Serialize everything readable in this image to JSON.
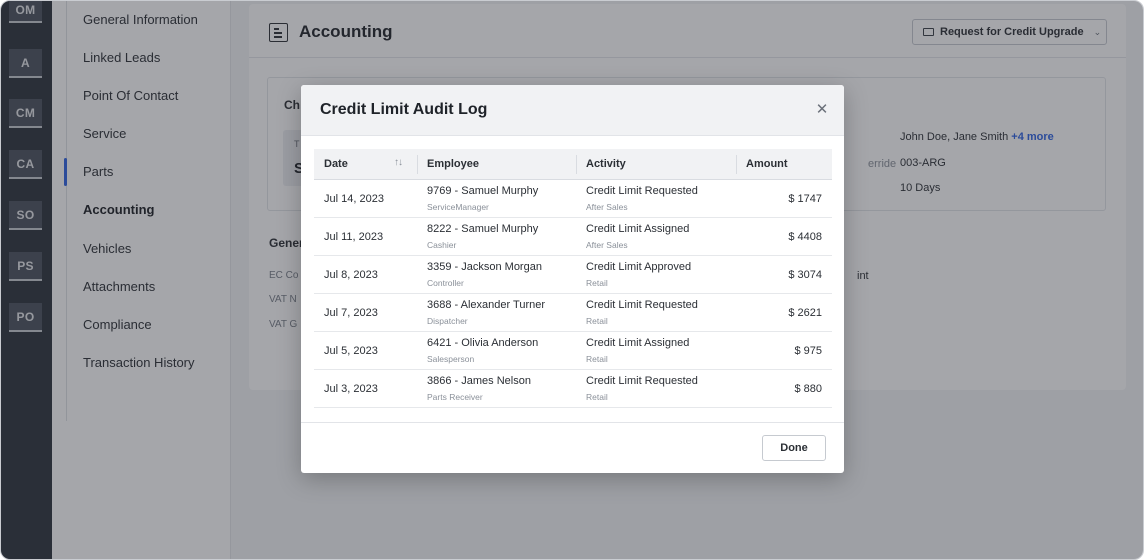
{
  "rail": {
    "items": [
      "OM",
      "A",
      "CM",
      "CA",
      "SO",
      "PS",
      "PO"
    ]
  },
  "sidenav": {
    "items": [
      {
        "label": "General Information"
      },
      {
        "label": "Linked Leads"
      },
      {
        "label": "Point Of Contact"
      },
      {
        "label": "Service"
      },
      {
        "label": "Parts"
      },
      {
        "label": "Accounting"
      },
      {
        "label": "Vehicles"
      },
      {
        "label": "Attachments"
      },
      {
        "label": "Compliance"
      },
      {
        "label": "Transaction History"
      }
    ],
    "active": "Accounting"
  },
  "header": {
    "title": "Accounting",
    "credit_button_label": "Request for Credit Upgrade"
  },
  "background": {
    "section_title_partial": "Ch",
    "tile_t1": "T",
    "tile_t2": "S",
    "right_label_partial": "erride",
    "right_values": [
      "John Doe, Jane Smith",
      "003-ARG",
      "10 Days"
    ],
    "more_link": "+4 more",
    "general_title_partial": "Gener",
    "general_labels": [
      "EC Co",
      "VAT N",
      "VAT G"
    ],
    "general_value_partial": "int"
  },
  "modal": {
    "title": "Credit Limit Audit Log",
    "close_icon": "close-icon",
    "columns": [
      "Date",
      "Employee",
      "Activity",
      "Amount"
    ],
    "rows": [
      {
        "date": "Jul 14, 2023",
        "employee": "9769 -  Samuel Murphy",
        "role": "ServiceManager",
        "activity": "Credit Limit Requested",
        "dept": "After Sales",
        "amount": "$ 1747"
      },
      {
        "date": "Jul 11, 2023",
        "employee": "8222 -  Samuel Murphy",
        "role": "Cashier",
        "activity": "Credit Limit Assigned",
        "dept": "After Sales",
        "amount": "$ 4408"
      },
      {
        "date": "Jul 8, 2023",
        "employee": "3359 -  Jackson Morgan",
        "role": "Controller",
        "activity": "Credit Limit Approved",
        "dept": "Retail",
        "amount": "$ 3074"
      },
      {
        "date": "Jul 7, 2023",
        "employee": "3688 -  Alexander Turner",
        "role": "Dispatcher",
        "activity": "Credit Limit Requested",
        "dept": "Retail",
        "amount": "$ 2621"
      },
      {
        "date": "Jul 5, 2023",
        "employee": "6421 -  Olivia Anderson",
        "role": "Salesperson",
        "activity": "Credit Limit Assigned",
        "dept": "Retail",
        "amount": "$ 975"
      },
      {
        "date": "Jul 3, 2023",
        "employee": "3866 -  James Nelson",
        "role": "Parts Receiver",
        "activity": "Credit Limit Requested",
        "dept": "Retail",
        "amount": "$ 880"
      }
    ],
    "done_label": "Done"
  },
  "colors": {
    "rail_bg": "#2c323b",
    "accent": "#2d63e4",
    "overlay": "rgba(40,44,52,0.42)"
  }
}
